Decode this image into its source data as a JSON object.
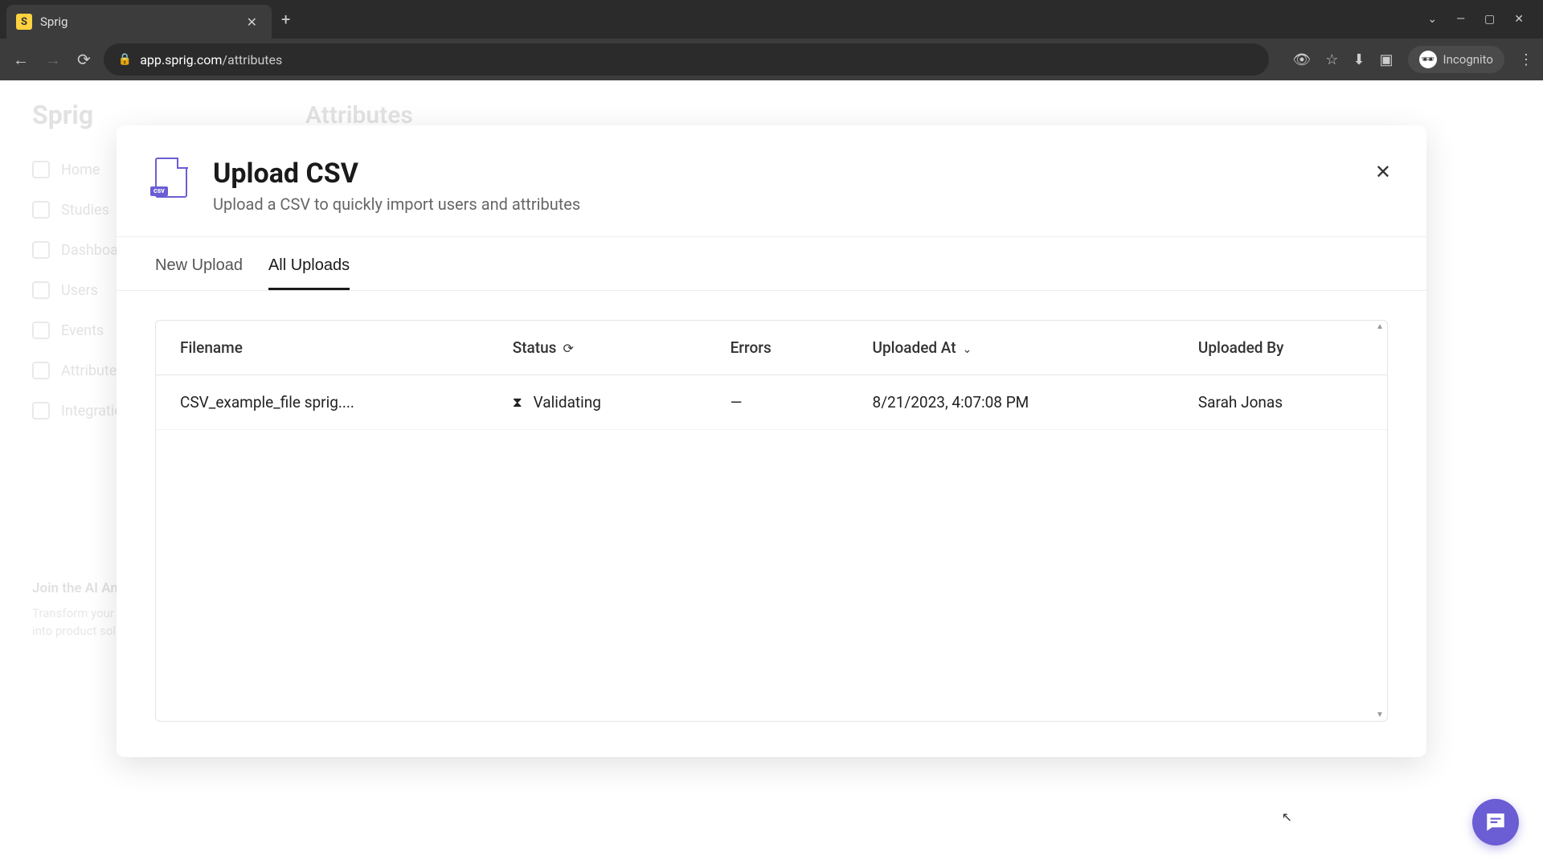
{
  "browser": {
    "tab_title": "Sprig",
    "favicon_letter": "S",
    "url_domain": "app.sprig.com",
    "url_path": "/attributes",
    "incognito_label": "Incognito"
  },
  "background": {
    "logo": "Sprig",
    "title": "Attributes",
    "sidebar": [
      "Home",
      "Studies",
      "Dashboards",
      "Users",
      "Events",
      "Attributes",
      "Integrations"
    ],
    "promo_title": "Join the AI Analysis Waitlist ✨",
    "promo_body": "Transform your customer responses into product solutions using AI."
  },
  "modal": {
    "title": "Upload CSV",
    "subtitle": "Upload a CSV to quickly import users and attributes",
    "csv_badge": "csv",
    "tabs": {
      "new_upload": "New Upload",
      "all_uploads": "All Uploads"
    },
    "columns": {
      "filename": "Filename",
      "status": "Status",
      "errors": "Errors",
      "uploaded_at": "Uploaded At",
      "uploaded_by": "Uploaded By"
    },
    "rows": [
      {
        "filename": "CSV_example_file sprig....",
        "status": "Validating",
        "errors": "—",
        "uploaded_at": "8/21/2023, 4:07:08 PM",
        "uploaded_by": "Sarah Jonas"
      }
    ]
  }
}
